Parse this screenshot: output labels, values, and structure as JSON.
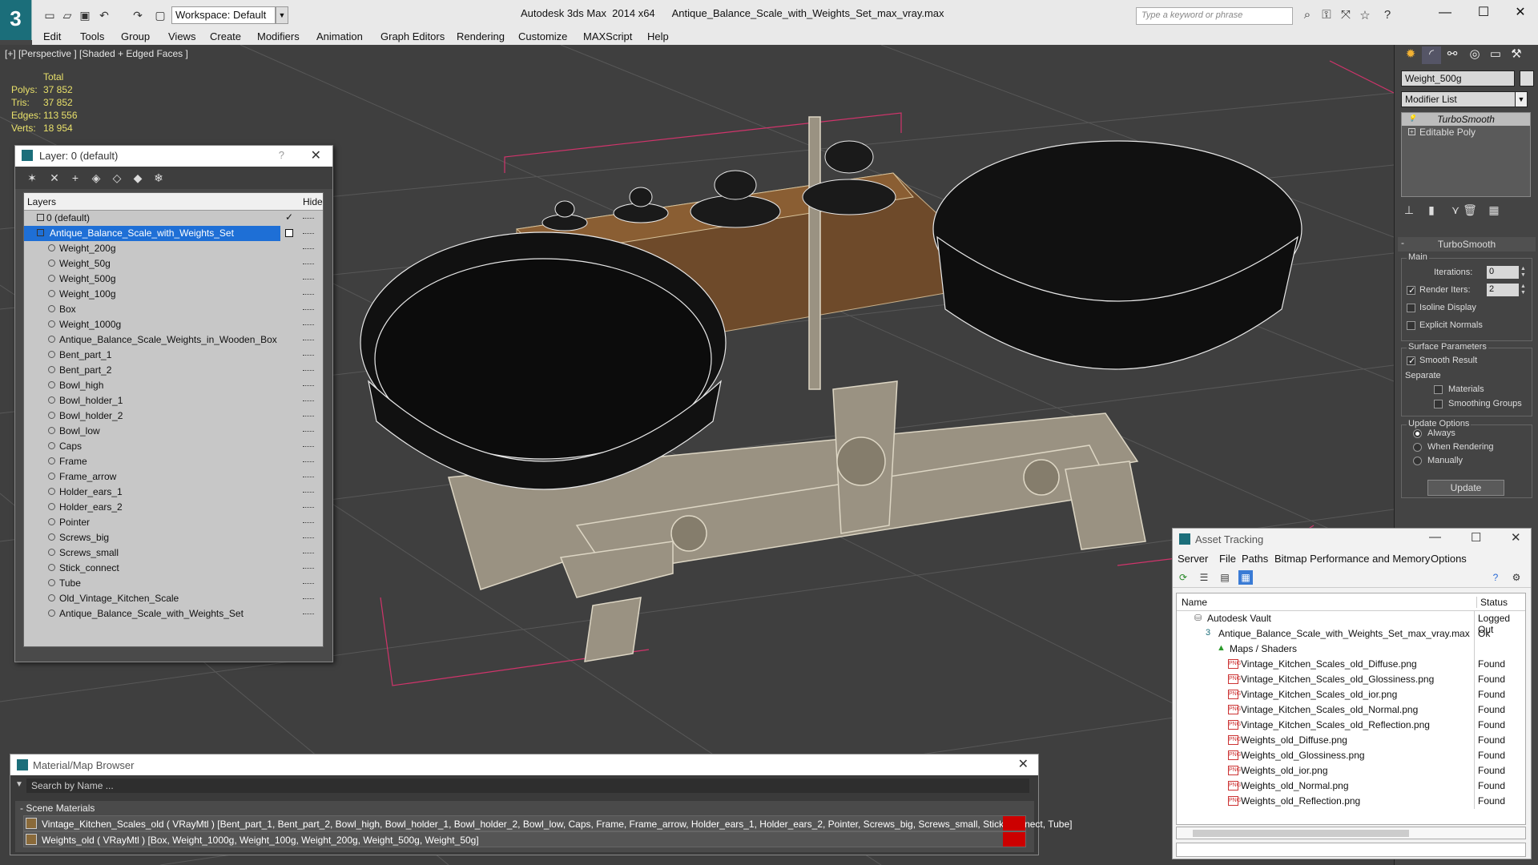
{
  "titlebar": {
    "app_title": "Autodesk 3ds Max  2014 x64",
    "file_title": "Antique_Balance_Scale_with_Weights_Set_max_vray.max",
    "workspace": "Workspace: Default",
    "search_placeholder": "Type a keyword or phrase"
  },
  "menu": [
    "Edit",
    "Tools",
    "Group",
    "Views",
    "Create",
    "Modifiers",
    "Animation",
    "Graph Editors",
    "Rendering",
    "Customize",
    "MAXScript",
    "Help"
  ],
  "viewport": {
    "label": "[+] [Perspective ] [Shaded + Edged Faces ]",
    "stats": {
      "header": "Total",
      "rows": [
        {
          "k": "Polys:",
          "v": "37 852"
        },
        {
          "k": "Tris:",
          "v": "37 852"
        },
        {
          "k": "Edges:",
          "v": "113 556"
        },
        {
          "k": "Verts:",
          "v": "18 954"
        }
      ]
    }
  },
  "layer_panel": {
    "title": "Layer: 0 (default)",
    "help": "?",
    "col_layers": "Layers",
    "col_hide": "Hide",
    "rows": [
      {
        "name": "0 (default)",
        "type": "layer"
      },
      {
        "name": "Antique_Balance_Scale_with_Weights_Set",
        "type": "layer",
        "selected": true
      },
      {
        "name": "Weight_200g",
        "type": "obj"
      },
      {
        "name": "Weight_50g",
        "type": "obj"
      },
      {
        "name": "Weight_500g",
        "type": "obj"
      },
      {
        "name": "Weight_100g",
        "type": "obj"
      },
      {
        "name": "Box",
        "type": "obj"
      },
      {
        "name": "Weight_1000g",
        "type": "obj"
      },
      {
        "name": "Antique_Balance_Scale_Weights_in_Wooden_Box",
        "type": "obj"
      },
      {
        "name": "Bent_part_1",
        "type": "obj"
      },
      {
        "name": "Bent_part_2",
        "type": "obj"
      },
      {
        "name": "Bowl_high",
        "type": "obj"
      },
      {
        "name": "Bowl_holder_1",
        "type": "obj"
      },
      {
        "name": "Bowl_holder_2",
        "type": "obj"
      },
      {
        "name": "Bowl_low",
        "type": "obj"
      },
      {
        "name": "Caps",
        "type": "obj"
      },
      {
        "name": "Frame",
        "type": "obj"
      },
      {
        "name": "Frame_arrow",
        "type": "obj"
      },
      {
        "name": "Holder_ears_1",
        "type": "obj"
      },
      {
        "name": "Holder_ears_2",
        "type": "obj"
      },
      {
        "name": "Pointer",
        "type": "obj"
      },
      {
        "name": "Screws_big",
        "type": "obj"
      },
      {
        "name": "Screws_small",
        "type": "obj"
      },
      {
        "name": "Stick_connect",
        "type": "obj"
      },
      {
        "name": "Tube",
        "type": "obj"
      },
      {
        "name": "Old_Vintage_Kitchen_Scale",
        "type": "obj"
      },
      {
        "name": "Antique_Balance_Scale_with_Weights_Set",
        "type": "obj"
      }
    ]
  },
  "command_panel": {
    "object_name": "Weight_500g",
    "modifier_list": "Modifier List",
    "stack": [
      "TurboSmooth",
      "Editable Poly"
    ],
    "rollout_title": "TurboSmooth",
    "main_label": "Main",
    "iterations_label": "Iterations:",
    "iterations_value": "0",
    "render_iters_label": "Render Iters:",
    "render_iters_value": "2",
    "isoline_label": "Isoline Display",
    "explicit_normals_label": "Explicit Normals",
    "surface_params_label": "Surface Parameters",
    "smooth_result_label": "Smooth Result",
    "separate_label": "Separate",
    "materials_label": "Materials",
    "smoothing_groups_label": "Smoothing Groups",
    "update_options_label": "Update Options",
    "always_label": "Always",
    "when_rendering_label": "When Rendering",
    "manually_label": "Manually",
    "update_button": "Update"
  },
  "asset_tracking": {
    "title": "Asset Tracking",
    "menu": [
      "Server",
      "File",
      "Paths",
      "Bitmap Performance and Memory",
      "Options"
    ],
    "col_name": "Name",
    "col_status": "Status",
    "rows": [
      {
        "name": "Autodesk Vault",
        "status": "Logged Out",
        "indent": 1,
        "icon": "vault"
      },
      {
        "name": "Antique_Balance_Scale_with_Weights_Set_max_vray.max",
        "status": "Ok",
        "indent": 2,
        "icon": "max"
      },
      {
        "name": "Maps / Shaders",
        "status": "",
        "indent": 3,
        "icon": "maps"
      },
      {
        "name": "Vintage_Kitchen_Scales_old_Diffuse.png",
        "status": "Found",
        "indent": 4,
        "icon": "png"
      },
      {
        "name": "Vintage_Kitchen_Scales_old_Glossiness.png",
        "status": "Found",
        "indent": 4,
        "icon": "png"
      },
      {
        "name": "Vintage_Kitchen_Scales_old_ior.png",
        "status": "Found",
        "indent": 4,
        "icon": "png"
      },
      {
        "name": "Vintage_Kitchen_Scales_old_Normal.png",
        "status": "Found",
        "indent": 4,
        "icon": "png"
      },
      {
        "name": "Vintage_Kitchen_Scales_old_Reflection.png",
        "status": "Found",
        "indent": 4,
        "icon": "png"
      },
      {
        "name": "Weights_old_Diffuse.png",
        "status": "Found",
        "indent": 4,
        "icon": "png"
      },
      {
        "name": "Weights_old_Glossiness.png",
        "status": "Found",
        "indent": 4,
        "icon": "png"
      },
      {
        "name": "Weights_old_ior.png",
        "status": "Found",
        "indent": 4,
        "icon": "png"
      },
      {
        "name": "Weights_old_Normal.png",
        "status": "Found",
        "indent": 4,
        "icon": "png"
      },
      {
        "name": "Weights_old_Reflection.png",
        "status": "Found",
        "indent": 4,
        "icon": "png"
      }
    ]
  },
  "material_browser": {
    "title": "Material/Map Browser",
    "search_placeholder": "Search by Name ...",
    "group": "- Scene Materials",
    "materials": [
      "Vintage_Kitchen_Scales_old  ( VRayMtl ) [Bent_part_1, Bent_part_2, Bowl_high, Bowl_holder_1, Bowl_holder_2, Bowl_low, Caps, Frame, Frame_arrow, Holder_ears_1, Holder_ears_2, Pointer, Screws_big, Screws_small, Stick_connect, Tube]",
      "Weights_old  ( VRayMtl ) [Box, Weight_1000g, Weight_100g, Weight_200g, Weight_500g, Weight_50g]"
    ]
  },
  "colors": {
    "accent": "#1e6fd6",
    "brand": "#1b6e7a",
    "stats": "#e8e06a",
    "viewport_bg": "#3f3f3f"
  }
}
